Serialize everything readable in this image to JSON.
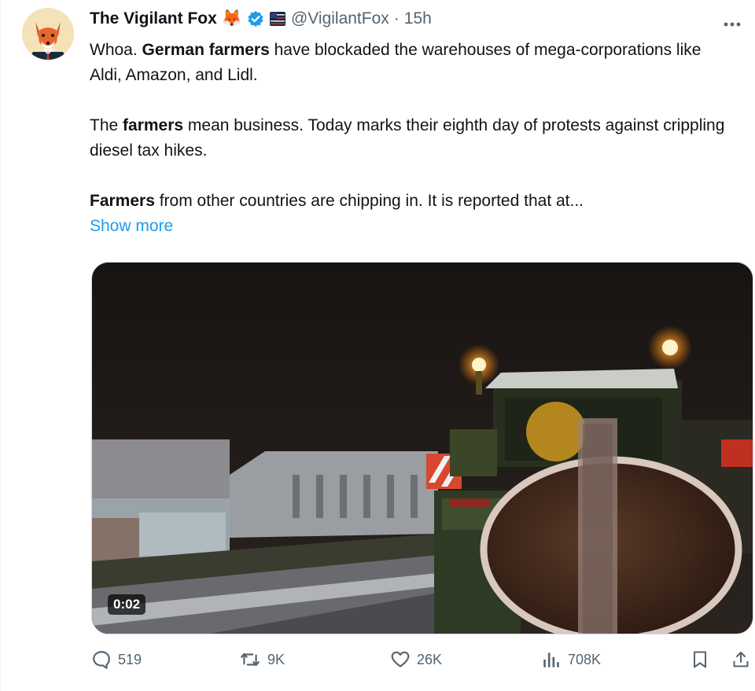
{
  "tweet": {
    "author_name": "The Vigilant Fox",
    "handle": "@VigilantFox",
    "separator": "·",
    "time": "15h",
    "badges": [
      "fox-emoji",
      "verified-check",
      "flag-affiliate"
    ],
    "fox_emoji": "🦊",
    "paragraph1": {
      "pre": "Whoa. ",
      "bold": "German farmers",
      "post": " have blockaded the warehouses of mega-corporations like Aldi, Amazon, and Lidl."
    },
    "paragraph2": {
      "pre": "The ",
      "bold": "farmers",
      "post": " mean business. Today marks their eighth day of protests against crippling diesel tax hikes."
    },
    "paragraph3": {
      "bold": "Farmers",
      "post": " from other countries are chipping in. It is reported that at..."
    },
    "show_more": "Show more",
    "media": {
      "duration": "0:02"
    },
    "actions": {
      "replies": "519",
      "reposts": "9K",
      "likes": "26K",
      "views": "708K"
    }
  },
  "colors": {
    "accent": "#1d9bf0",
    "text": "#0f1419",
    "muted": "#536471",
    "verified": "#1d9bf0"
  },
  "icons": {
    "more": "more-horizontal-icon",
    "reply": "reply-bubble-icon",
    "repost": "repost-icon",
    "like": "heart-icon",
    "views": "analytics-bars-icon",
    "bookmark": "bookmark-icon",
    "share": "share-icon"
  }
}
